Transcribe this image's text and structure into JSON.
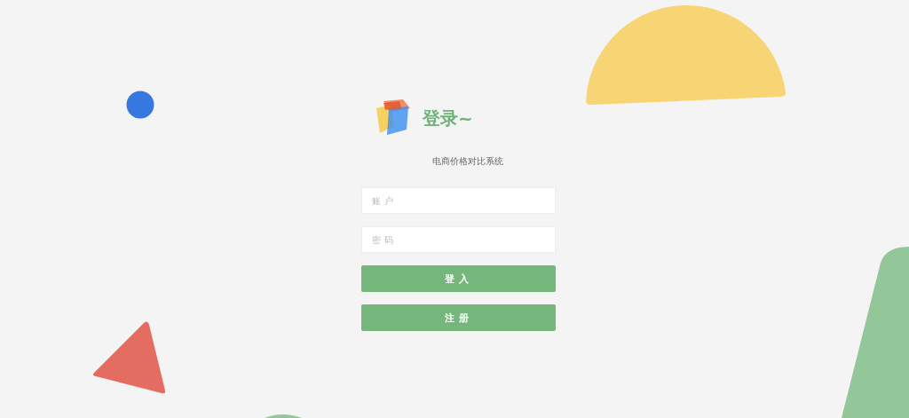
{
  "login": {
    "title": "登录~",
    "subtitle": "电商价格对比系统",
    "fields": [
      {
        "placeholder": "账户"
      },
      {
        "placeholder": "密码"
      }
    ],
    "buttons": [
      "登入",
      "注册"
    ]
  }
}
